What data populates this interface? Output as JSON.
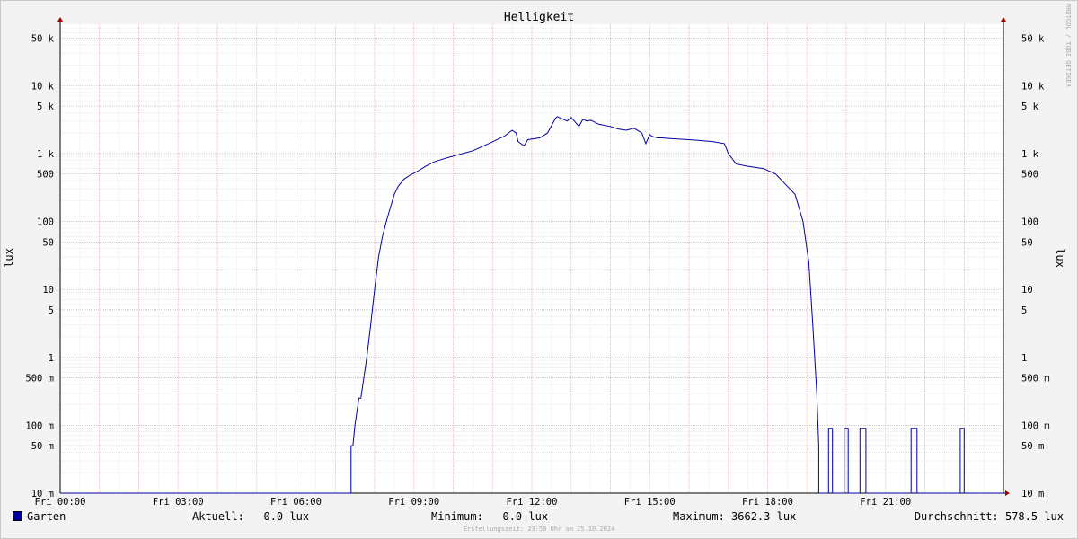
{
  "chart_data": {
    "type": "line",
    "title": "Helligkeit",
    "ylabel": "lux",
    "yscale": "log",
    "ylim": [
      0.01,
      80000
    ],
    "xlim": [
      0,
      24
    ],
    "grid": true,
    "x_tick_labels": [
      "Fri 00:00",
      "Fri 03:00",
      "Fri 06:00",
      "Fri 09:00",
      "Fri 12:00",
      "Fri 15:00",
      "Fri 18:00",
      "Fri 21:00"
    ],
    "x_tick_hours": [
      0,
      3,
      6,
      9,
      12,
      15,
      18,
      21
    ],
    "y_tick_values": [
      0.01,
      0.05,
      0.1,
      0.5,
      1,
      5,
      10,
      50,
      100,
      500,
      1000,
      5000,
      10000,
      50000
    ],
    "y_tick_labels": [
      "10 m",
      "50 m",
      "100 m",
      "500 m",
      "1",
      "5",
      "10",
      "50",
      "100",
      "500",
      "1 k",
      "5 k",
      "10 k",
      "50 k"
    ],
    "series": [
      {
        "name": "Garten",
        "color": "#0000a0",
        "x": [
          0,
          7.4,
          7.4,
          7.45,
          7.5,
          7.6,
          7.65,
          7.8,
          7.9,
          8.0,
          8.1,
          8.2,
          8.3,
          8.4,
          8.5,
          8.6,
          8.75,
          8.9,
          9.1,
          9.3,
          9.5,
          9.8,
          10.1,
          10.5,
          10.9,
          11.3,
          11.5,
          11.6,
          11.65,
          11.8,
          11.9,
          12.2,
          12.4,
          12.55,
          12.6,
          12.65,
          12.9,
          13.0,
          13.2,
          13.3,
          13.4,
          13.5,
          13.7,
          14.0,
          14.2,
          14.4,
          14.6,
          14.8,
          14.9,
          15.0,
          15.05,
          15.2,
          15.3,
          15.6,
          16.0,
          16.3,
          16.6,
          16.9,
          17.0,
          17.2,
          17.5,
          17.9,
          18.2,
          18.4,
          18.7,
          18.9,
          19.05,
          19.15,
          19.25,
          19.3,
          19.3,
          19.5,
          19.55,
          19.55,
          19.65,
          19.65,
          19.95,
          19.95,
          20.05,
          20.05,
          20.35,
          20.35,
          20.5,
          20.5,
          21.65,
          21.65,
          21.8,
          21.8,
          22.9,
          22.9,
          23.0,
          23.0,
          24
        ],
        "y": [
          0.01,
          0.01,
          0.05,
          0.05,
          0.1,
          0.25,
          0.25,
          1,
          3,
          10,
          30,
          60,
          100,
          160,
          250,
          330,
          420,
          480,
          550,
          650,
          750,
          850,
          950,
          1100,
          1400,
          1800,
          2200,
          2000,
          1500,
          1300,
          1600,
          1700,
          2000,
          2900,
          3300,
          3500,
          3000,
          3400,
          2500,
          3200,
          3000,
          3100,
          2700,
          2500,
          2300,
          2200,
          2350,
          2000,
          1400,
          1900,
          1800,
          1700,
          1700,
          1650,
          1600,
          1550,
          1500,
          1400,
          1000,
          700,
          650,
          600,
          500,
          380,
          250,
          100,
          25,
          3,
          0.3,
          0.05,
          0.01,
          0.01,
          0.01,
          0.09,
          0.09,
          0.01,
          0.01,
          0.09,
          0.09,
          0.01,
          0.01,
          0.09,
          0.09,
          0.01,
          0.01,
          0.09,
          0.09,
          0.01,
          0.01,
          0.09,
          0.09,
          0.01,
          0.01
        ]
      }
    ]
  },
  "watermark": "RRDTOOL / TOBI OETIKER",
  "legend": {
    "name": "Garten",
    "current": "Aktuell:   0.0 lux",
    "minimum": "Minimum:   0.0 lux",
    "maximum": "Maximum: 3662.3 lux",
    "average": "Durchschnitt: 578.5 lux"
  },
  "footer": "Erstellungszeit: 23:58 Uhr am 25.10.2024"
}
